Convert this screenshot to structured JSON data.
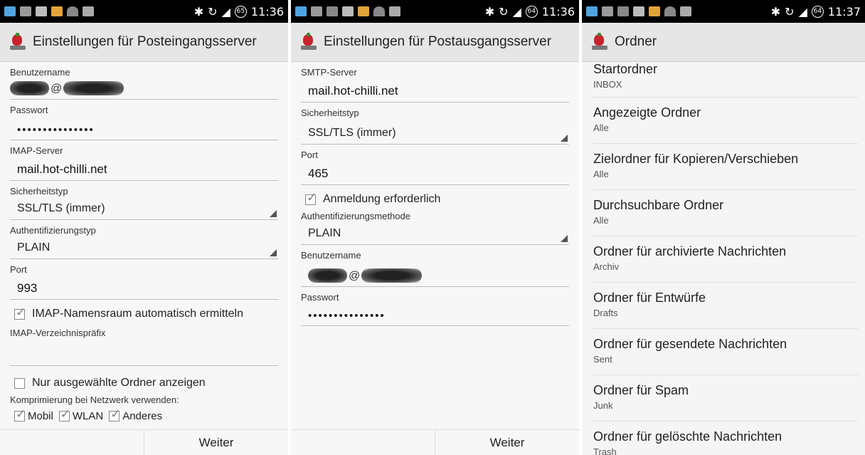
{
  "status1": {
    "time": "11:36",
    "badge": "65"
  },
  "status2": {
    "time": "11:36",
    "badge": "64"
  },
  "status3": {
    "time": "11:37",
    "badge": "64"
  },
  "colors": {
    "statusbar": "#000000",
    "actionbar": "#e6e6e6",
    "app_icon": "#c8232c"
  },
  "incoming": {
    "title": "Einstellungen für Posteingangsserver",
    "username_label": "Benutzername",
    "username_at": "@",
    "password_label": "Passwort",
    "password_value": "•••••••••••••••",
    "imap_server_label": "IMAP-Server",
    "imap_server_value": "mail.hot-chilli.net",
    "security_label": "Sicherheitstyp",
    "security_value": "SSL/TLS (immer)",
    "auth_label": "Authentifizierungstyp",
    "auth_value": "PLAIN",
    "port_label": "Port",
    "port_value": "993",
    "namespace_check": "IMAP-Namensraum automatisch ermitteln",
    "prefix_label": "IMAP-Verzeichnispräfix",
    "prefix_value": "",
    "only_selected_check": "Nur ausgewählte Ordner anzeigen",
    "compression_label": "Komprimierung bei Netzwerk verwenden:",
    "compression_options": [
      "Mobil",
      "WLAN",
      "Anderes"
    ],
    "next_button": "Weiter"
  },
  "outgoing": {
    "title": "Einstellungen für Postausgangsserver",
    "smtp_label": "SMTP-Server",
    "smtp_value": "mail.hot-chilli.net",
    "security_label": "Sicherheitstyp",
    "security_value": "SSL/TLS (immer)",
    "port_label": "Port",
    "port_value": "465",
    "login_check": "Anmeldung erforderlich",
    "auth_label": "Authentifizierungsmethode",
    "auth_value": "PLAIN",
    "username_label": "Benutzername",
    "username_at": "@",
    "password_label": "Passwort",
    "password_value": "•••••••••••••••",
    "next_button": "Weiter"
  },
  "folders": {
    "title": "Ordner",
    "items": [
      {
        "title": "Startordner",
        "sub": "INBOX"
      },
      {
        "title": "Angezeigte Ordner",
        "sub": "Alle"
      },
      {
        "title": "Zielordner für Kopieren/Verschieben",
        "sub": "Alle"
      },
      {
        "title": "Durchsuchbare Ordner",
        "sub": "Alle"
      },
      {
        "title": "Ordner für archivierte Nachrichten",
        "sub": "Archiv"
      },
      {
        "title": "Ordner für Entwürfe",
        "sub": "Drafts"
      },
      {
        "title": "Ordner für gesendete Nachrichten",
        "sub": "Sent"
      },
      {
        "title": "Ordner für Spam",
        "sub": "Junk"
      },
      {
        "title": "Ordner für gelöschte Nachrichten",
        "sub": "Trash"
      }
    ]
  }
}
